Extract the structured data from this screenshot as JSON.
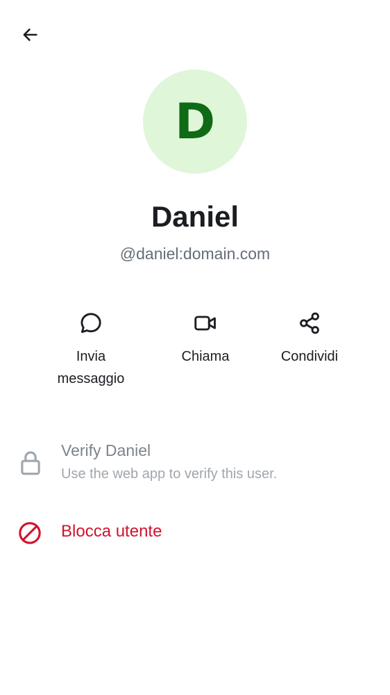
{
  "header": {
    "back_icon": "arrow-left-icon"
  },
  "profile": {
    "avatar_letter": "D",
    "avatar_bg": "#dff6d8",
    "avatar_fg": "#0f6a15",
    "display_name": "Daniel",
    "user_id": "@daniel:domain.com"
  },
  "actions": [
    {
      "icon": "chat-bubble-icon",
      "label_line1": "Invia",
      "label_line2": "messaggio"
    },
    {
      "icon": "video-camera-icon",
      "label": "Chiama"
    },
    {
      "icon": "share-icon",
      "label": "Condividi"
    }
  ],
  "verify": {
    "icon": "lock-icon",
    "title": "Verify Daniel",
    "subtitle": "Use the web app to verify this user."
  },
  "block": {
    "icon": "block-icon",
    "label": "Blocca utente",
    "color": "#d1132c"
  }
}
